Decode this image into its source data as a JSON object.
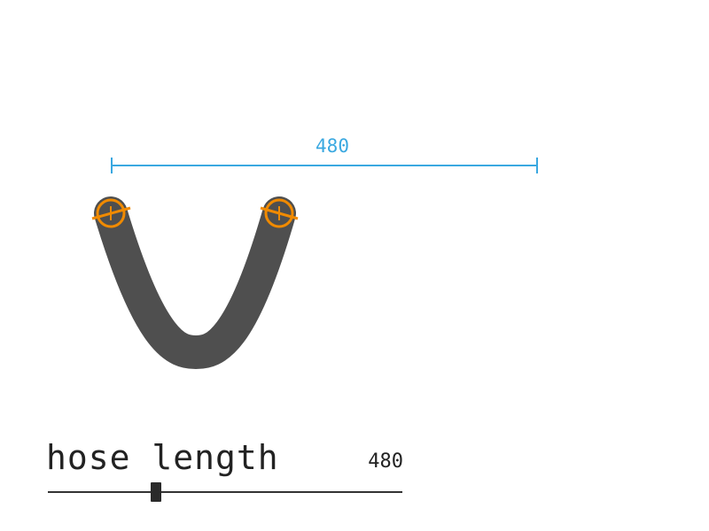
{
  "measurement": {
    "value": "480",
    "color": "#3aa8e0"
  },
  "hose": {
    "color": "#4f4f4f",
    "connector_color": "#f08a00",
    "connector_icon": "crosshair-circle-icon"
  },
  "control": {
    "label": "hose length",
    "value": "480",
    "slider_fraction": 0.29
  }
}
